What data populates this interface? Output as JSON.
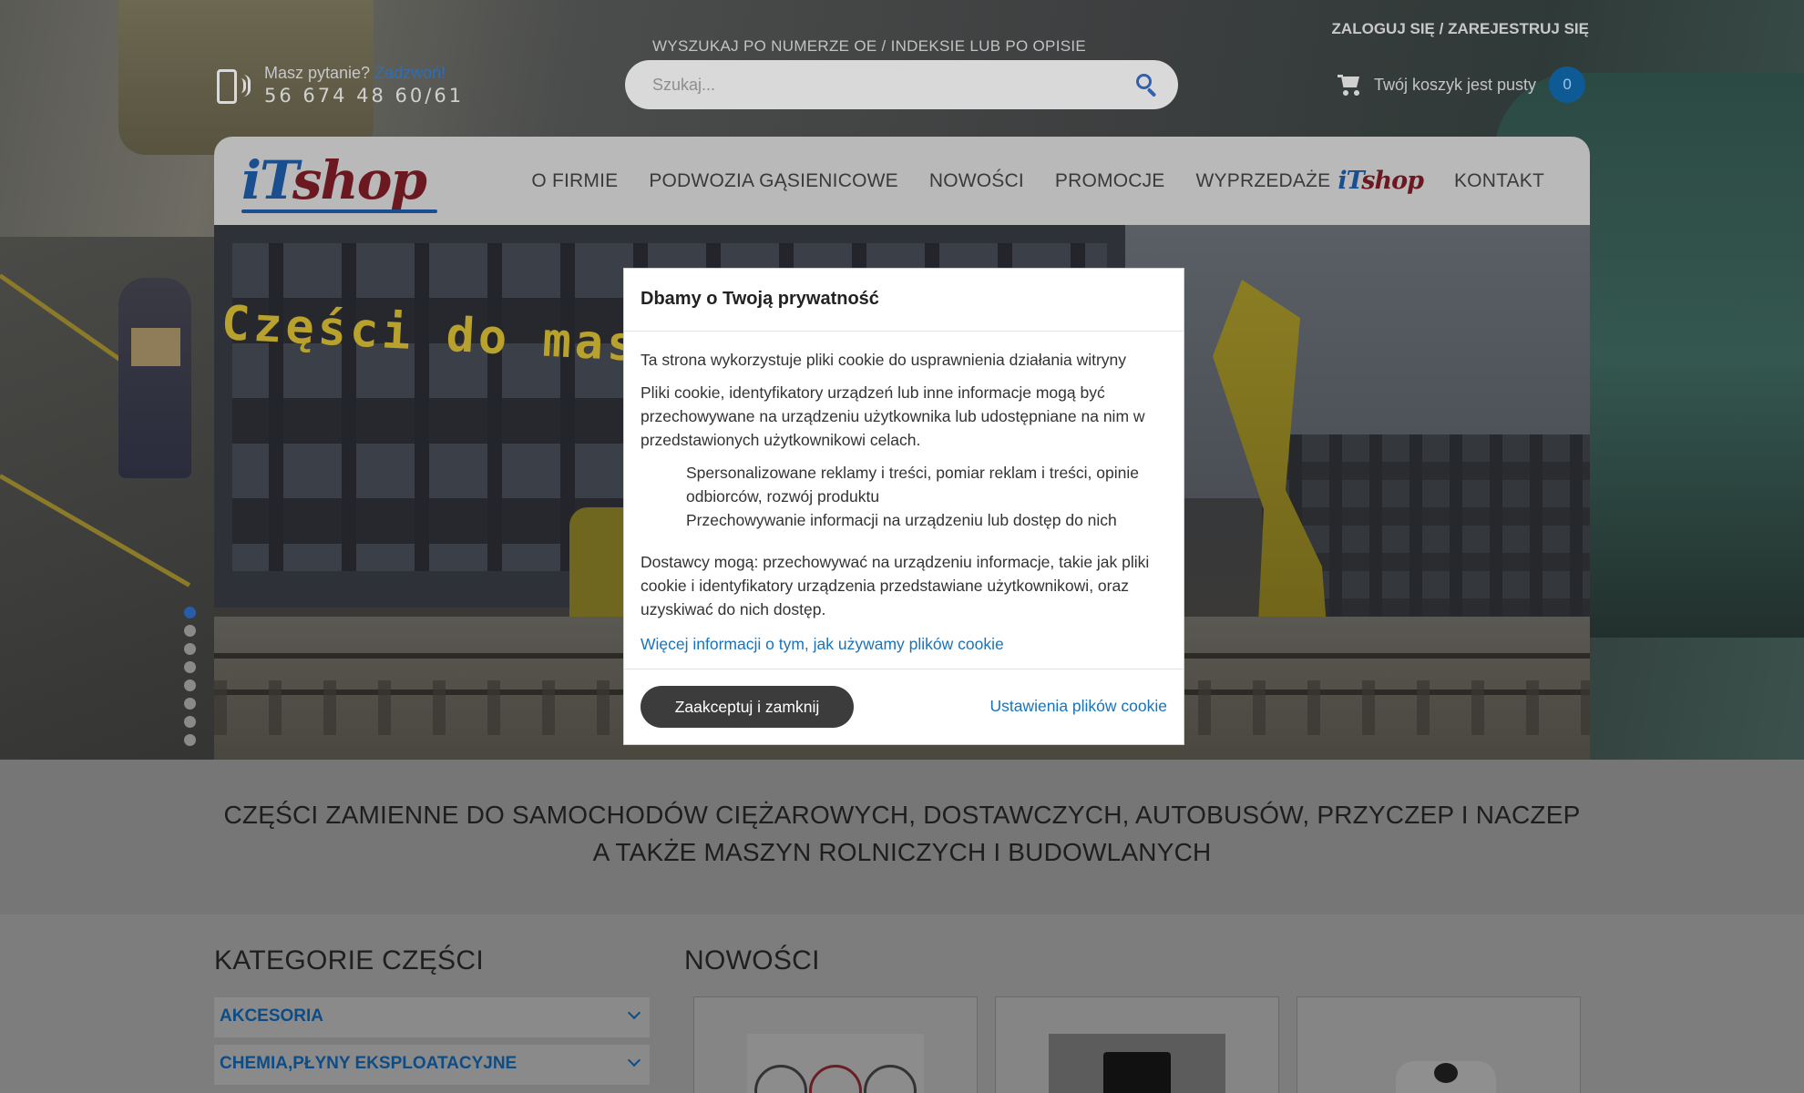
{
  "header": {
    "phone_question": "Masz pytanie?",
    "phone_call": "Zadzwoń!",
    "phone_number": "56 674 48 60/61",
    "search_label": "WYSZUKAJ PO NUMERZE OE / INDEKSIE LUB PO OPISIE",
    "search_placeholder": "Szukaj...",
    "login": "ZALOGUJ SIĘ / ZAREJESTRUJ SIĘ",
    "cart_text": "Twój koszyk jest pusty",
    "cart_count": "0"
  },
  "nav": {
    "logo_i": "i",
    "logo_t": "T",
    "logo_shop": "shop",
    "items": [
      {
        "label": "O FIRMIE"
      },
      {
        "label": "PODWOZIA GĄSIENICOWE"
      },
      {
        "label": "NOWOŚCI"
      },
      {
        "label": "PROMOCJE"
      },
      {
        "label": "WYPRZEDAŻE"
      },
      {
        "label": "KONTAKT"
      }
    ]
  },
  "slide": {
    "title": "Części do maszy",
    "dot_count": 8,
    "active_dot": 1
  },
  "tagline": "CZĘŚCI ZAMIENNE DO SAMOCHODÓW CIĘŻAROWYCH, DOSTAWCZYCH, AUTOBUSÓW, PRZYCZEP I NACZEP A TAKŻE MASZYN ROLNICZYCH I BUDOWLANYCH",
  "categories": {
    "title": "KATEGORIE CZĘŚCI",
    "items": [
      {
        "label": "AKCESORIA"
      },
      {
        "label": "CHEMIA,PŁYNY EKSPLOATACYJNE"
      }
    ]
  },
  "news": {
    "title": "NOWOŚCI"
  },
  "cookie": {
    "title": "Dbamy o Twoją prywatność",
    "intro": "Ta strona wykorzystuje pliki cookie do usprawnienia działania witryny",
    "details": "Pliki cookie, identyfikatory urządzeń lub inne informacje mogą być przechowywane na urządzeniu użytkownika lub udostępniane na nim w przedstawionych użytkownikowi celach.",
    "purposes": [
      "Spersonalizowane reklamy i treści, pomiar reklam i treści, opinie odbiorców, rozwój produktu",
      "Przechowywanie informacji na urządzeniu lub dostęp do nich"
    ],
    "vendors": "Dostawcy mogą: przechowywać na urządzeniu informacje, takie jak pliki cookie i identyfikatory urządzenia przedstawiane użytkownikowi, oraz uzyskiwać do nich dostęp.",
    "more_link": "Więcej informacji o tym, jak używamy plików cookie",
    "accept_button": "Zaakceptuj i zamknij",
    "settings_link": "Ustawienia plików cookie"
  },
  "colors": {
    "accent_blue": "#1a73b8",
    "logo_blue": "#1a4f8f",
    "logo_red": "#6b1820",
    "button_dark": "#3c3c3c"
  }
}
